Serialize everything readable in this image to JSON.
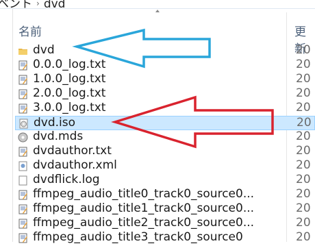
{
  "breadcrumb": {
    "parent": "ベント",
    "current": "dvd"
  },
  "columns": {
    "name": "名前",
    "date": "更新"
  },
  "files": [
    {
      "name": "dvd",
      "type": "folder",
      "date": "20"
    },
    {
      "name": "0.0.0_log.txt",
      "type": "text",
      "date": "20"
    },
    {
      "name": "1.0.0_log.txt",
      "type": "text",
      "date": "20"
    },
    {
      "name": "2.0.0_log.txt",
      "type": "text",
      "date": "20"
    },
    {
      "name": "3.0.0_log.txt",
      "type": "text",
      "date": "20"
    },
    {
      "name": "dvd.iso",
      "type": "disc-image",
      "date": "20",
      "selected": true
    },
    {
      "name": "dvd.mds",
      "type": "mds",
      "date": "20"
    },
    {
      "name": "dvdauthor.txt",
      "type": "text",
      "date": "20"
    },
    {
      "name": "dvdauthor.xml",
      "type": "xml",
      "date": "20"
    },
    {
      "name": "dvdflick.log",
      "type": "log",
      "date": "20"
    },
    {
      "name": "ffmpeg_audio_title0_track0_source0...",
      "type": "text",
      "date": "20"
    },
    {
      "name": "ffmpeg_audio_title1_track0_source0...",
      "type": "text",
      "date": "20"
    },
    {
      "name": "ffmpeg_audio_title2_track0_source0...",
      "type": "text",
      "date": "20"
    },
    {
      "name": "ffmpeg_audio_title3_track0_source0",
      "type": "text",
      "date": "20"
    }
  ],
  "annotations": {
    "blue_arrow_color": "#2aa6da",
    "red_arrow_color": "#d9232e"
  }
}
